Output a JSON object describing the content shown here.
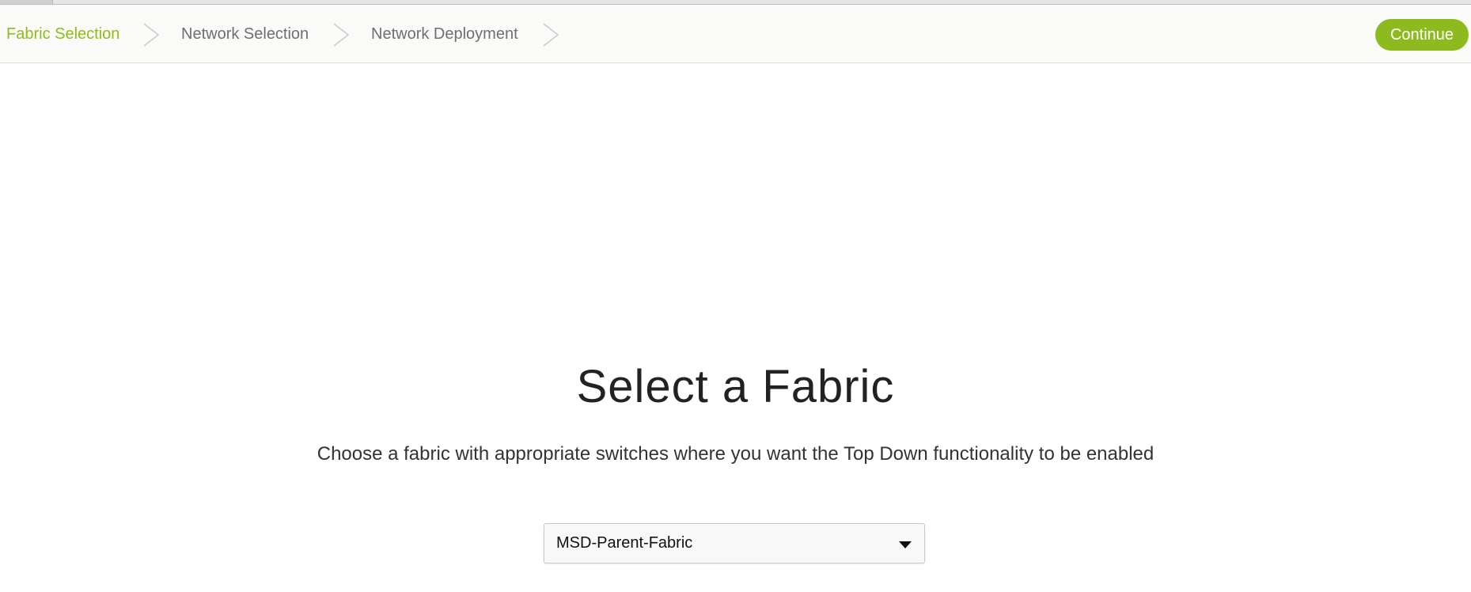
{
  "wizard": {
    "steps": [
      {
        "label": "Fabric Selection",
        "state": "active"
      },
      {
        "label": "Network Selection",
        "state": "inactive"
      },
      {
        "label": "Network Deployment",
        "state": "inactive"
      }
    ],
    "continue_label": "Continue"
  },
  "main": {
    "title": "Select a Fabric",
    "subtitle": "Choose a fabric with appropriate switches where you want the Top Down functionality to be enabled",
    "fabric_select": {
      "selected": "MSD-Parent-Fabric"
    }
  },
  "icons": {
    "step_separator": "chevron-right-icon",
    "dropdown": "caret-down-icon"
  },
  "colors": {
    "accent": "#8dbb1f",
    "active_step": "#8fbc1c",
    "inactive_step": "#6f6f6f"
  }
}
